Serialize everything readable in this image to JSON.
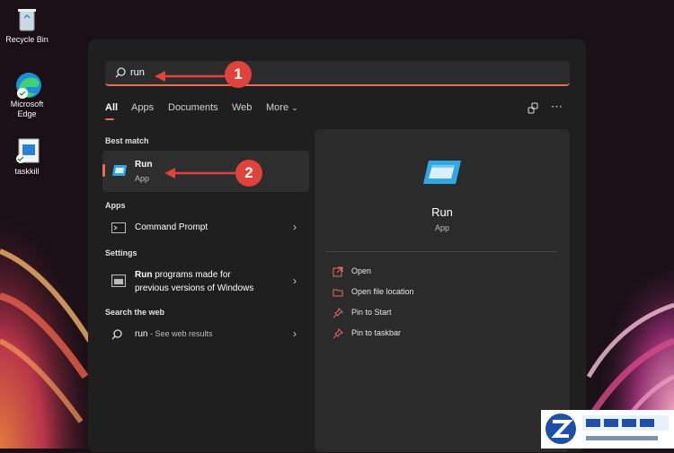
{
  "desktop": {
    "icons": [
      {
        "label": "Recycle Bin",
        "icon": "recycle-bin-icon"
      },
      {
        "label": "Microsoft Edge",
        "icon": "edge-icon"
      },
      {
        "label": "taskkill",
        "icon": "document-icon"
      }
    ]
  },
  "search": {
    "query": "run",
    "icon": "search-icon"
  },
  "tabs": [
    {
      "label": "All",
      "active": true
    },
    {
      "label": "Apps"
    },
    {
      "label": "Documents"
    },
    {
      "label": "Web"
    },
    {
      "label": "More"
    }
  ],
  "sections": {
    "best_match": "Best match",
    "apps": "Apps",
    "settings": "Settings",
    "search_web": "Search the web"
  },
  "results": {
    "best_match": {
      "title": "Run",
      "subtitle": "App"
    },
    "command_prompt": {
      "title": "Command Prompt"
    },
    "settings_item": {
      "bold": "Run",
      "rest": " programs made for",
      "line2": "previous versions of Windows"
    },
    "web_search": {
      "term": "run",
      "suffix": " - See web results"
    }
  },
  "detail": {
    "title": "Run",
    "subtitle": "App",
    "actions": [
      "Open",
      "Open file location",
      "Pin to Start",
      "Pin to taskbar"
    ]
  },
  "callouts": [
    "1",
    "2"
  ],
  "colors": {
    "accent": "#e86c5a",
    "callout": "#e0423c",
    "run_icon": "#2fa8e8"
  }
}
